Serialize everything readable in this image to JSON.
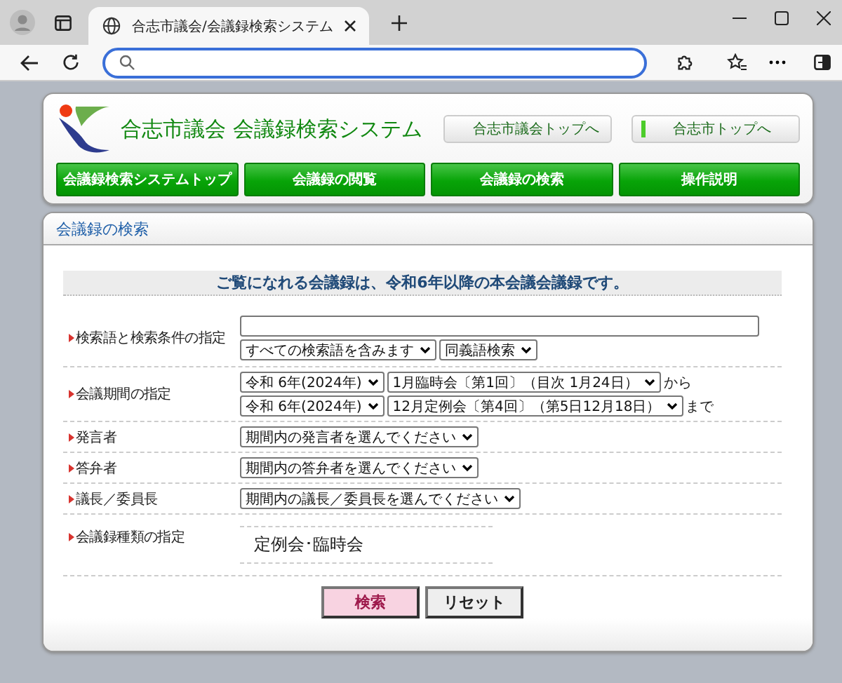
{
  "browser": {
    "tab_title": "合志市議会/会議録検索システム"
  },
  "header": {
    "title": "合志市議会 会議録検索システム",
    "links": [
      "合志市議会トップへ",
      "合志市トップへ"
    ],
    "nav": [
      "会議録検索システムトップ",
      "会議録の閲覧",
      "会議録の検索",
      "操作説明"
    ]
  },
  "search": {
    "heading": "会議録の検索",
    "notice": "ご覧になれる会議録は、令和6年以降の本会議会議録です。",
    "rows": [
      {
        "kind": "keyword",
        "label": "検索語と検索条件の指定",
        "selects": [
          "すべての検索語を含みます",
          "同義語検索"
        ]
      },
      {
        "kind": "period",
        "label": "会議期間の指定",
        "lines": [
          {
            "selects": [
              "令和 6年(2024年)",
              "1月臨時会〔第1回〕（目次 1月24日）"
            ],
            "suffix": "から"
          },
          {
            "selects": [
              "令和 6年(2024年)",
              "12月定例会〔第4回〕（第5日12月18日）"
            ],
            "suffix": "まで"
          }
        ]
      },
      {
        "kind": "select",
        "label": "発言者",
        "selects": [
          "期間内の発言者を選んでください"
        ]
      },
      {
        "kind": "select",
        "label": "答弁者",
        "selects": [
          "期間内の答弁者を選んでください"
        ]
      },
      {
        "kind": "select",
        "label": "議長／委員長",
        "selects": [
          "期間内の議長／委員長を選んでください"
        ]
      },
      {
        "kind": "types",
        "label": "会議録種類の指定",
        "value": "定例会･臨時会"
      }
    ],
    "buttons": [
      {
        "label": "検索",
        "kind": "primary"
      },
      {
        "label": "リセット",
        "kind": "secondary"
      }
    ]
  }
}
